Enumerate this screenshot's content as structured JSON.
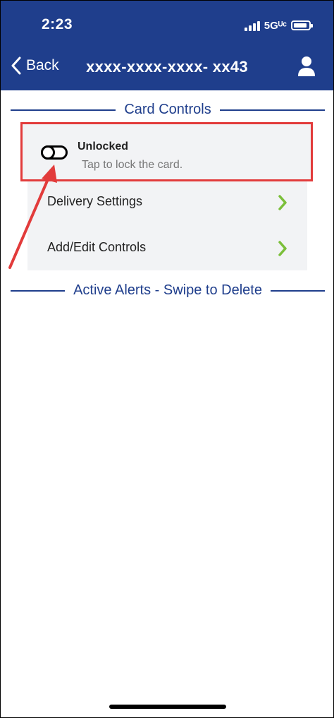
{
  "status_bar": {
    "time": "2:23",
    "network": "5Gᵁᶜ"
  },
  "header": {
    "back_label": "Back",
    "title": "xxxx-xxxx-xxxx- xx43"
  },
  "card_controls": {
    "heading": "Card Controls",
    "lock_toggle": {
      "status": "Unlocked",
      "hint": "Tap to lock the card.",
      "is_locked": false
    },
    "items": [
      {
        "label": "Delivery Settings"
      },
      {
        "label": "Add/Edit Controls"
      }
    ]
  },
  "alerts": {
    "heading": "Active Alerts - Swipe to Delete"
  },
  "colors": {
    "brand": "#1f3e8c",
    "chevron": "#7bbf3a",
    "annotation": "#e23b3b"
  },
  "icons": {
    "back": "chevron-left-icon",
    "profile": "person-icon",
    "toggle": "toggle-off-icon",
    "chevron": "chevron-right-icon"
  }
}
